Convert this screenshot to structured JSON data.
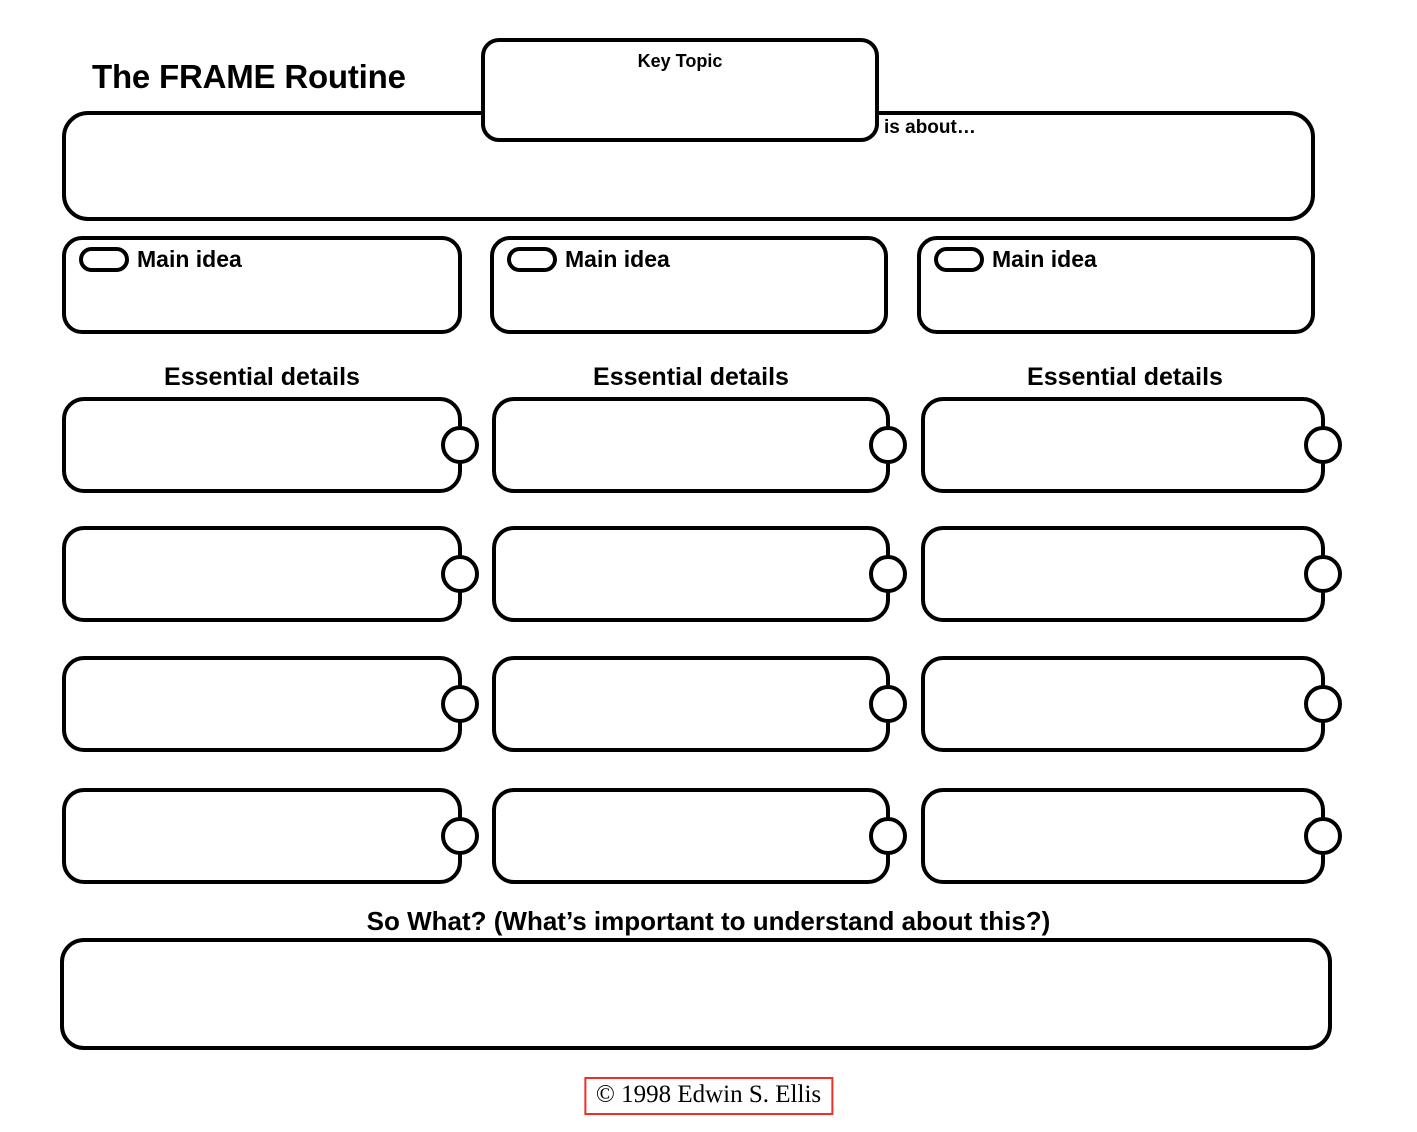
{
  "page": {
    "title": "The FRAME Routine",
    "background_color": "#ffffff",
    "line_color": "#000000"
  },
  "key_topic": {
    "label": "Key Topic"
  },
  "is_about": {
    "label": "is about…",
    "value": ""
  },
  "main_ideas": [
    {
      "label": "Main idea",
      "icon": "pill-icon",
      "value": ""
    },
    {
      "label": "Main idea",
      "icon": "pill-icon",
      "value": ""
    },
    {
      "label": "Main idea",
      "icon": "pill-icon",
      "value": ""
    }
  ],
  "essential_details": {
    "headings": [
      "Essential details",
      "Essential details",
      "Essential details"
    ],
    "rows": 4,
    "columns": 3,
    "cells": [
      [
        {
          "value": ""
        },
        {
          "value": ""
        },
        {
          "value": ""
        }
      ],
      [
        {
          "value": ""
        },
        {
          "value": ""
        },
        {
          "value": ""
        }
      ],
      [
        {
          "value": ""
        },
        {
          "value": ""
        },
        {
          "value": ""
        }
      ],
      [
        {
          "value": ""
        },
        {
          "value": ""
        },
        {
          "value": ""
        }
      ]
    ]
  },
  "so_what": {
    "heading": "So What? (What’s important to understand about this?)",
    "value": ""
  },
  "copyright": {
    "text": "© 1998 Edwin S. Ellis",
    "border_color": "#ee3124"
  }
}
